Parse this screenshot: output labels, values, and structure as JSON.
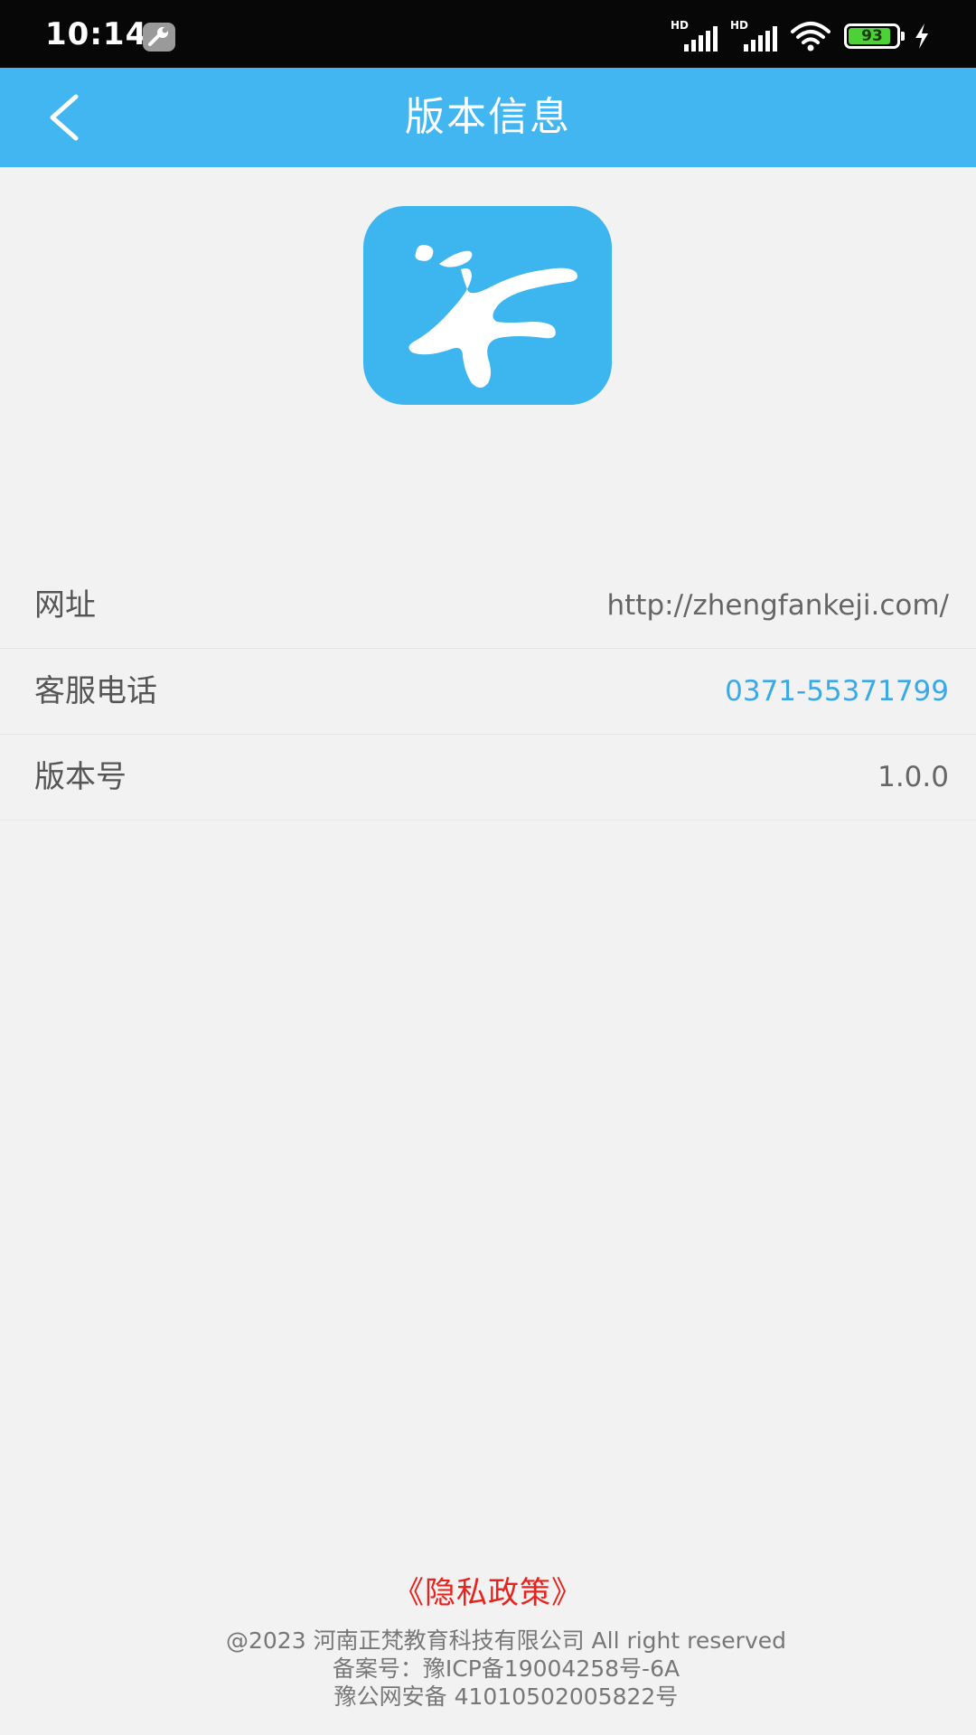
{
  "status_bar": {
    "time": "10:14",
    "battery_level": "93",
    "signal_1_label": "HD",
    "signal_2_label": "HD"
  },
  "header": {
    "title": "版本信息"
  },
  "info": {
    "rows": [
      {
        "label": "网址",
        "value": "http://zhengfankeji.com/"
      },
      {
        "label": "客服电话",
        "value": "0371-55371799"
      },
      {
        "label": "版本号",
        "value": "1.0.0"
      }
    ]
  },
  "footer": {
    "privacy_link": "《隐私政策》",
    "copyright": "@2023 河南正梵教育科技有限公司 All right reserved",
    "icp": "备案号：豫ICP备19004258号-6A",
    "police": "豫公网安备 41010502005822号"
  },
  "colors": {
    "accent": "#41b6f0",
    "link": "#3aa9e6",
    "privacy": "#e8221d"
  },
  "icons": {
    "back": "chevron-left-icon",
    "logo": "app-logo-icon",
    "wrench": "wrench-icon",
    "wifi": "wifi-icon",
    "charging": "lightning-icon"
  }
}
